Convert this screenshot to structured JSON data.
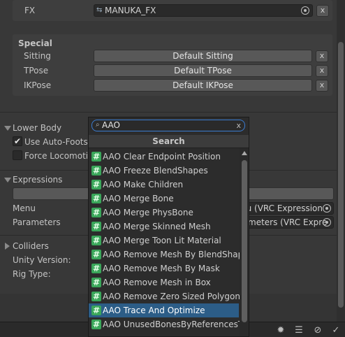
{
  "fx": {
    "label": "FX",
    "value": "MANUKA_FX",
    "target_icon": "target-icon",
    "clear_label": "x"
  },
  "special": {
    "title": "Special",
    "rows": [
      {
        "label": "Sitting",
        "button": "Default Sitting",
        "clear": "x"
      },
      {
        "label": "TPose",
        "button": "Default TPose",
        "clear": "x"
      },
      {
        "label": "IKPose",
        "button": "Default IKPose",
        "clear": "x"
      }
    ]
  },
  "lower_body": {
    "title": "Lower Body",
    "use_auto_footstep": "Use Auto-Footst",
    "use_auto_footstep_checked": true,
    "force_locomotion": "Force Locomotio",
    "force_locomotion_checked": false
  },
  "expressions": {
    "title": "Expressions",
    "menu_label": "Menu",
    "menu_value": "nu (VRC Expression",
    "parameters_label": "Parameters",
    "parameters_value": "meters (VRC Expre"
  },
  "colliders": {
    "title": "Colliders"
  },
  "unity_version_label": "Unity Version:",
  "rig_type_label": "Rig Type:",
  "popup": {
    "search_value": "AAO",
    "clear_icon": "x",
    "header": "Search",
    "items": [
      "AAO Clear Endpoint Position",
      "AAO Freeze BlendShapes",
      "AAO Make Children",
      "AAO Merge Bone",
      "AAO Merge PhysBone",
      "AAO Merge Skinned Mesh",
      "AAO Merge Toon Lit Material",
      "AAO Remove Mesh By BlendShape",
      "AAO Remove Mesh By Mask",
      "AAO Remove Mesh in Box",
      "AAO Remove Zero Sized Polygon",
      "AAO Trace And Optimize",
      "AAO UnusedBonesByReferencesTool"
    ],
    "selected": "AAO Trace And Optimize",
    "hash_glyph": "#"
  },
  "status_icons": [
    "bug-icon",
    "layers-icon",
    "eye-slash-icon",
    "check-circle-icon"
  ]
}
